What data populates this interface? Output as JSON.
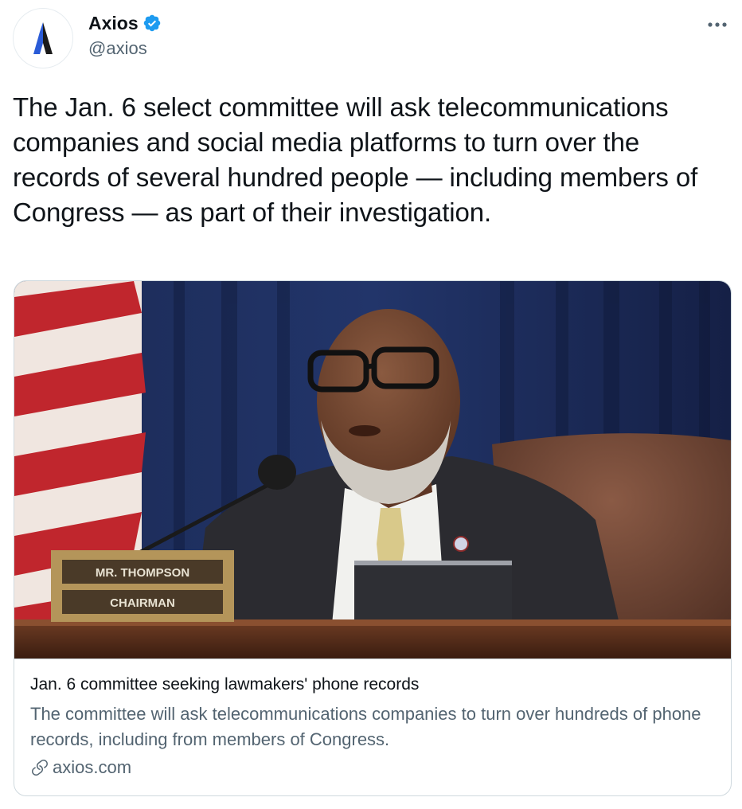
{
  "author": {
    "display_name": "Axios",
    "handle": "@axios",
    "verified": true,
    "avatar_icon": "axios-logo-icon"
  },
  "actions": {
    "more_icon": "more-options-icon"
  },
  "tweet": {
    "text": "The Jan. 6 select committee will ask telecommunications companies and social media platforms to turn over the records of several hundred people — including members of Congress — as part of their investigation."
  },
  "card": {
    "image_nameplate_line1": "MR. THOMPSON",
    "image_nameplate_line2": "CHAIRMAN",
    "title": "Jan. 6 committee seeking lawmakers' phone records",
    "description": "The committee will ask telecommunications companies to turn over hundreds of phone records, including from members of Congress.",
    "domain": "axios.com",
    "domain_icon": "link-icon"
  },
  "colors": {
    "text_primary": "#0f1419",
    "text_secondary": "#536471",
    "border": "#cfd9de",
    "verified_blue": "#1d9bf0",
    "axios_blue": "#2a5bd7"
  }
}
